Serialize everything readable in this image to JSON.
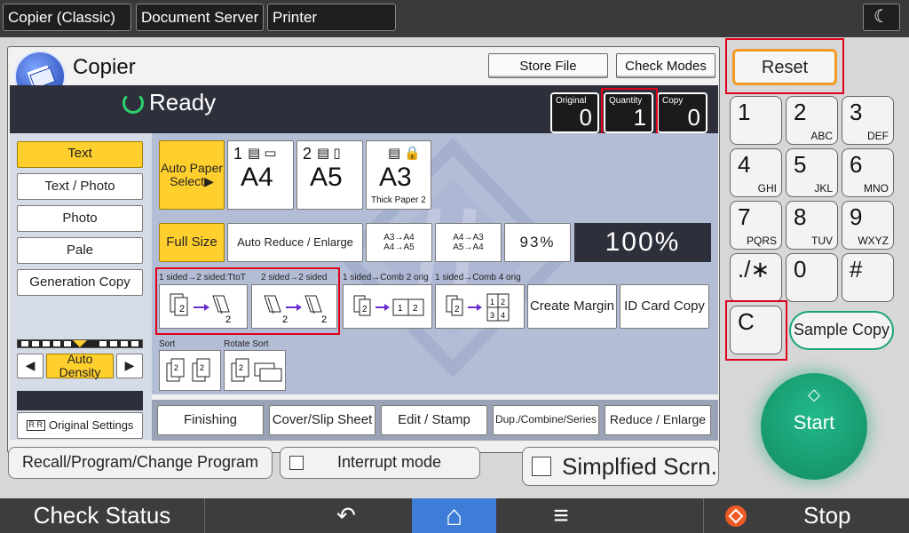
{
  "tabs": [
    "Copier (Classic)",
    "Document Server",
    "Printer"
  ],
  "moon_icon": "☾",
  "header": {
    "title": "Copier",
    "store_file": "Store File",
    "check_modes": "Check Modes"
  },
  "status": {
    "ready": "Ready"
  },
  "counters": {
    "original_label": "Original",
    "original_value": "0",
    "quantity_label": "Quantity",
    "quantity_value": "1",
    "copy_label": "Copy",
    "copy_value": "0"
  },
  "modes": [
    "Text",
    "Text / Photo",
    "Photo",
    "Pale",
    "Generation Copy"
  ],
  "paper": {
    "auto_line1": "Auto Paper",
    "auto_line2": "Select▶",
    "tray1_num": "1",
    "tray1_size": "A4",
    "tray2_num": "2",
    "tray2_size": "A5",
    "tray3_size": "A3",
    "tray3_sub": "Thick Paper 2"
  },
  "zoom": {
    "full": "Full Size",
    "auto_reduce": "Auto Reduce / Enlarge",
    "r1a": "A3→A4",
    "r1b": "A4→A5",
    "r2a": "A4→A3",
    "r2b": "A5→A4",
    "pct": "93%",
    "big": "100%"
  },
  "duplex": {
    "l1": "1 sided→2 sided:TtoT",
    "l2": "2 sided→2 sided",
    "l3": "1 sided→Comb 2 orig",
    "l4": "1 sided→Comb 4 orig",
    "create_margin": "Create Margin",
    "id_card": "ID Card Copy"
  },
  "sort": {
    "sort_label": "Sort",
    "rotate_label": "Rotate Sort"
  },
  "density": {
    "label": "Auto Density"
  },
  "original_settings": "Original Settings",
  "bottom_tabs": [
    "Finishing",
    "Cover/Slip Sheet",
    "Edit / Stamp",
    "Dup./Combine/Series",
    "Reduce / Enlarge"
  ],
  "recall": "Recall/Program/Change Program",
  "interrupt": "Interrupt mode",
  "simplified": "Simplfied Scrn.",
  "reset": "Reset",
  "keys": [
    {
      "d": "1",
      "s": ""
    },
    {
      "d": "2",
      "s": "ABC"
    },
    {
      "d": "3",
      "s": "DEF"
    },
    {
      "d": "4",
      "s": "GHI"
    },
    {
      "d": "5",
      "s": "JKL"
    },
    {
      "d": "6",
      "s": "MNO"
    },
    {
      "d": "7",
      "s": "PQRS"
    },
    {
      "d": "8",
      "s": "TUV"
    },
    {
      "d": "9",
      "s": "WXYZ"
    },
    {
      "d": "./∗",
      "s": ""
    },
    {
      "d": "0",
      "s": ""
    },
    {
      "d": "#",
      "s": ""
    }
  ],
  "clear": "C",
  "sample_copy": "Sample Copy",
  "start": "Start",
  "footer": {
    "check_status": "Check Status",
    "back_icon": "↶",
    "home_icon": "⌂",
    "menu_icon": "≡",
    "stop": "Stop"
  },
  "colors": {
    "highlight": "#e0001a",
    "selected": "#ffcf2e",
    "start": "#1aa57a"
  }
}
